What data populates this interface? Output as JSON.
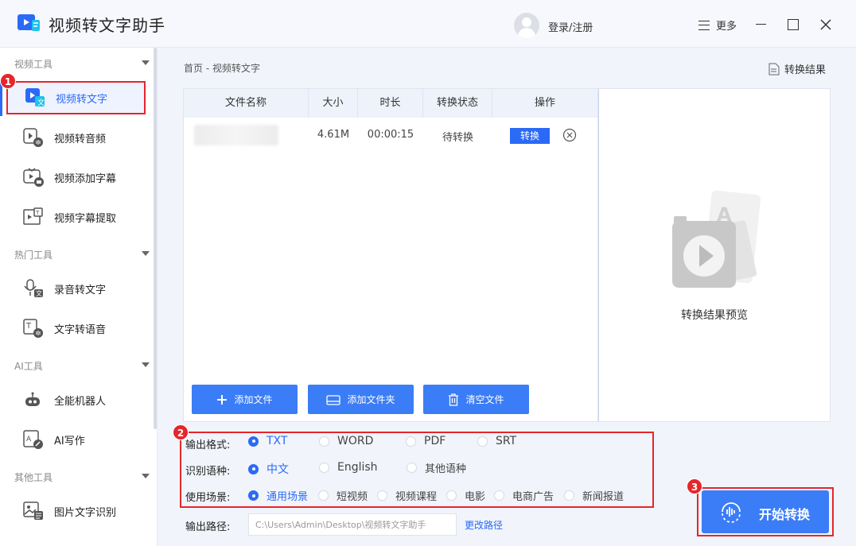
{
  "app": {
    "title": "视频转文字助手",
    "login": "登录/注册",
    "more": "更多"
  },
  "sidebar": {
    "groups": [
      {
        "label": "视频工具",
        "items": [
          "视频转文字",
          "视频转音频",
          "视频添加字幕",
          "视频字幕提取"
        ]
      },
      {
        "label": "热门工具",
        "items": [
          "录音转文字",
          "文字转语音"
        ]
      },
      {
        "label": "AI工具",
        "items": [
          "全能机器人",
          "AI写作"
        ]
      },
      {
        "label": "其他工具",
        "items": [
          "图片文字识别"
        ]
      }
    ],
    "active": "视频转文字"
  },
  "badges": {
    "b1": "1",
    "b2": "2",
    "b3": "3"
  },
  "breadcrumb": "首页 - 视频转文字",
  "result_link": "转换结果",
  "table": {
    "headers": [
      "文件名称",
      "大小",
      "时长",
      "转换状态",
      "操作"
    ],
    "rows": [
      {
        "size": "4.61M",
        "duration": "00:00:15",
        "status": "待转换",
        "action": "转换"
      }
    ]
  },
  "buttons": {
    "add_file": "添加文件",
    "add_folder": "添加文件夹",
    "clear_files": "清空文件",
    "start": "开始转换"
  },
  "preview": {
    "label": "转换结果预览"
  },
  "options": {
    "format_label": "输出格式:",
    "formats": [
      "TXT",
      "WORD",
      "PDF",
      "SRT"
    ],
    "language_label": "识别语种:",
    "languages": [
      "中文",
      "English",
      "其他语种"
    ],
    "scene_label": "使用场景:",
    "scenes": [
      "通用场景",
      "短视频",
      "视频课程",
      "电影",
      "电商广告",
      "新闻报道"
    ]
  },
  "output": {
    "label": "输出路径:",
    "path": "C:\\Users\\Admin\\Desktop\\视频转文字助手",
    "change": "更改路径"
  },
  "colors": {
    "accent": "#2a6af5",
    "button": "#3b7df6",
    "highlight": "#e5262b"
  }
}
